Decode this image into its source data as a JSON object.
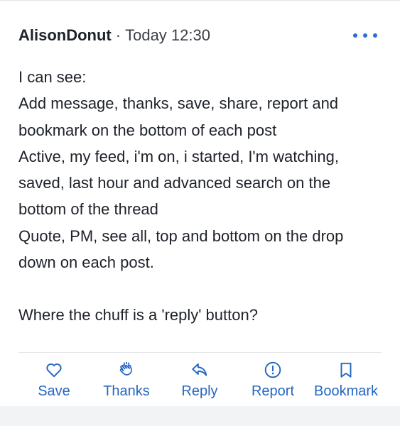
{
  "post": {
    "author": "AlisonDonut",
    "separator": "·",
    "time": "Today 12:30",
    "more_icon": "more-horizontal-icon",
    "body_lines": [
      "I can see:",
      "Add message, thanks, save, share, report and",
      "bookmark on the bottom of each post",
      "Active, my feed, i'm on, i started, I'm watching,",
      "saved, last hour and advanced search on the",
      "bottom of the thread",
      "Quote, PM, see all, top and bottom on the drop",
      "down on each post.",
      "",
      "Where the chuff is a 'reply' button?"
    ]
  },
  "actions": [
    {
      "label": "Save",
      "icon": "heart-icon"
    },
    {
      "label": "Thanks",
      "icon": "clap-icon"
    },
    {
      "label": "Reply",
      "icon": "reply-arrow-icon"
    },
    {
      "label": "Report",
      "icon": "alert-circle-icon"
    },
    {
      "label": "Bookmark",
      "icon": "bookmark-icon"
    }
  ],
  "colors": {
    "accent": "#2567c2",
    "text": "#1d2129",
    "background": "#f2f3f5",
    "card": "#ffffff"
  }
}
